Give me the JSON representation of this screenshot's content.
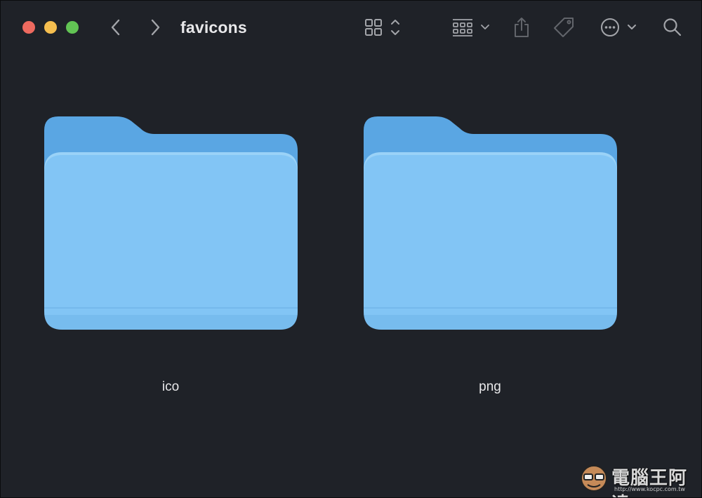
{
  "window": {
    "title": "favicons",
    "traffic_lights": {
      "close_color": "#ee6a5f",
      "minimize_color": "#f5be4f",
      "maximize_color": "#62c454"
    }
  },
  "toolbar": {
    "icons": [
      "back-icon",
      "forward-icon",
      "grid-view-icon",
      "group-icon",
      "share-icon",
      "tag-icon",
      "more-icon",
      "search-icon"
    ]
  },
  "folders": [
    {
      "name": "ico",
      "icon": "folder-icon"
    },
    {
      "name": "png",
      "icon": "folder-icon"
    }
  ],
  "colors": {
    "background": "#1f2228",
    "folder_front": "#82c5f5",
    "folder_back": "#5aa6e3",
    "text": "#e8e8ea"
  },
  "watermark": {
    "text": "電腦王阿達",
    "url": "http://www.kocpc.com.tw"
  }
}
